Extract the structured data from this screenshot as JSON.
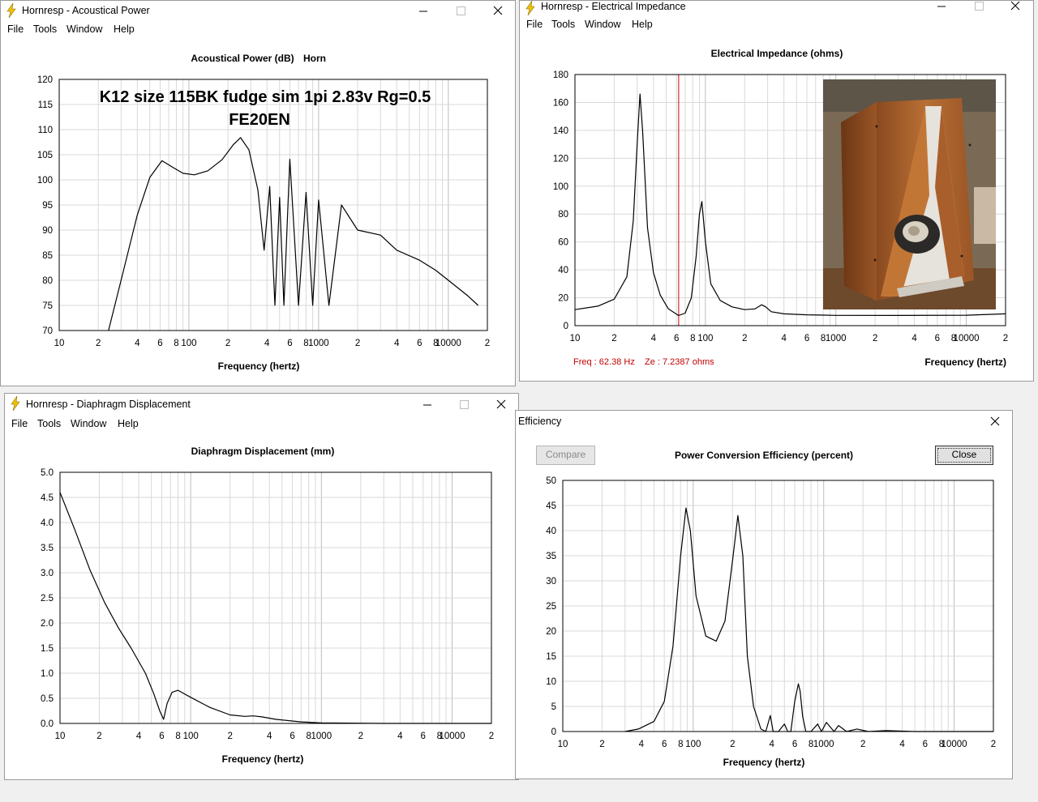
{
  "colors": {
    "grid": "#d9d9d9",
    "plot": "#000000",
    "marker": "#d00000",
    "readout": "#c00000",
    "disabled": "#8a8a8a"
  },
  "icons": {
    "app_icon": "lightning-bolt-icon",
    "minimize": "minimize-icon",
    "maximize": "maximize-icon",
    "close": "close-icon"
  },
  "menu": {
    "file": "File",
    "tools": "Tools",
    "window": "Window",
    "help": "Help"
  },
  "windows": {
    "acoustical": {
      "title": "Hornresp - Acoustical Power",
      "chart_title": "Acoustical Power (dB)",
      "chart_subtitle": "Horn",
      "annotation_line1": "K12 size 115BK fudge sim 1pi 2.83v Rg=0.5",
      "annotation_line2": "FE20EN",
      "xlabel": "Frequency (hertz)"
    },
    "impedance": {
      "title": "Hornresp - Electrical Impedance",
      "chart_title": "Electrical Impedance (ohms)",
      "xlabel": "Frequency (hertz)",
      "readout_freq": "Freq : 62.38 Hz",
      "readout_ze": "Ze : 7.2387 ohms"
    },
    "displacement": {
      "title": "Hornresp - Diaphragm Displacement",
      "chart_title": "Diaphragm Displacement (mm)",
      "xlabel": "Frequency (hertz)"
    },
    "efficiency": {
      "title": "Efficiency",
      "chart_title": "Power Conversion Efficiency (percent)",
      "xlabel": "Frequency (hertz)",
      "compare_label": "Compare",
      "close_label": "Close"
    }
  },
  "x_tick_labels": [
    "10",
    "2",
    "4",
    "6",
    "8",
    "100",
    "2",
    "4",
    "6",
    "8",
    "1000",
    "2",
    "4",
    "6",
    "8",
    "10000",
    "2"
  ],
  "chart_data": [
    {
      "type": "line",
      "title": "Acoustical Power (dB)",
      "xlabel": "Frequency (hertz)",
      "xscale": "log",
      "xlim": [
        10,
        20000
      ],
      "ylim": [
        70,
        120
      ],
      "yticks": [
        "70",
        "75",
        "80",
        "85",
        "90",
        "95",
        "100",
        "105",
        "110",
        "115",
        "120"
      ],
      "grid": true,
      "x": [
        24,
        30,
        40,
        50,
        62,
        75,
        90,
        110,
        140,
        180,
        220,
        250,
        290,
        340,
        380,
        420,
        460,
        500,
        540,
        600,
        700,
        800,
        900,
        1000,
        1200,
        1500,
        2000,
        3000,
        4000,
        6000,
        8000,
        10000,
        14000,
        17000
      ],
      "y": [
        70,
        80,
        93,
        100.5,
        103.8,
        102.5,
        101.3,
        101,
        101.8,
        104,
        107,
        108.4,
        106,
        98,
        86,
        98.7,
        75,
        96.5,
        75,
        104.1,
        75,
        97.5,
        75,
        96,
        75,
        95,
        90,
        89,
        86,
        84,
        82,
        80,
        77,
        75
      ]
    },
    {
      "type": "line",
      "title": "Electrical Impedance (ohms)",
      "xlabel": "Frequency (hertz)",
      "xscale": "log",
      "xlim": [
        10,
        20000
      ],
      "ylim": [
        0,
        180
      ],
      "yticks": [
        "0",
        "20",
        "40",
        "60",
        "80",
        "100",
        "120",
        "140",
        "160",
        "180"
      ],
      "grid": true,
      "marker_x": 62.38,
      "x": [
        10,
        15,
        20,
        25,
        28,
        30,
        31.5,
        33,
        36,
        40,
        45,
        52,
        62.38,
        70,
        78,
        85,
        90,
        94,
        100,
        110,
        130,
        160,
        200,
        240,
        270,
        290,
        320,
        400,
        600,
        1000,
        3000,
        10000,
        20000
      ],
      "y": [
        11.5,
        14,
        19,
        35,
        75,
        130,
        166,
        140,
        70,
        38,
        22,
        12,
        7.24,
        9,
        20,
        50,
        80,
        89,
        60,
        30,
        18,
        13.5,
        11.5,
        12,
        15,
        13.5,
        10,
        8.5,
        7.8,
        7.4,
        7.3,
        7.5,
        8.5
      ]
    },
    {
      "type": "line",
      "title": "Diaphragm Displacement (mm)",
      "xlabel": "Frequency (hertz)",
      "xscale": "log",
      "xlim": [
        10,
        20000
      ],
      "ylim": [
        0,
        5
      ],
      "yticks": [
        "0.0",
        "0.5",
        "1.0",
        "1.5",
        "2.0",
        "2.5",
        "3.0",
        "3.5",
        "4.0",
        "4.5",
        "5.0"
      ],
      "grid": true,
      "x": [
        10,
        13,
        17,
        22,
        28,
        35,
        45,
        52,
        58,
        62,
        66,
        72,
        80,
        100,
        140,
        200,
        260,
        300,
        350,
        450,
        700,
        1000,
        3000,
        20000
      ],
      "y": [
        4.6,
        3.85,
        3.05,
        2.4,
        1.9,
        1.5,
        1.0,
        0.6,
        0.25,
        0.08,
        0.4,
        0.62,
        0.66,
        0.52,
        0.32,
        0.17,
        0.14,
        0.15,
        0.13,
        0.08,
        0.03,
        0.01,
        0.0,
        0.0
      ]
    },
    {
      "type": "line",
      "title": "Power Conversion Efficiency (percent)",
      "xlabel": "Frequency (hertz)",
      "xscale": "log",
      "xlim": [
        10,
        20000
      ],
      "ylim": [
        0,
        50
      ],
      "yticks": [
        "0",
        "5",
        "10",
        "15",
        "20",
        "25",
        "30",
        "35",
        "40",
        "45",
        "50"
      ],
      "grid": true,
      "x": [
        30,
        38,
        50,
        60,
        70,
        80,
        88,
        95,
        105,
        125,
        150,
        175,
        200,
        220,
        240,
        260,
        290,
        330,
        360,
        390,
        410,
        450,
        500,
        530,
        560,
        600,
        640,
        660,
        690,
        730,
        800,
        900,
        960,
        1050,
        1200,
        1300,
        1500,
        1800,
        2200,
        3000,
        5000,
        20000
      ],
      "y": [
        0,
        0.5,
        2,
        6,
        17,
        35,
        44.5,
        40,
        27,
        19,
        18,
        22,
        34,
        43,
        35,
        15,
        5,
        0.5,
        0,
        3.2,
        0,
        0,
        1.5,
        0,
        0,
        6,
        9.5,
        8,
        3,
        0,
        0,
        1.5,
        0,
        1.8,
        0,
        1.2,
        0,
        0.5,
        0,
        0.2,
        0,
        0
      ]
    }
  ]
}
